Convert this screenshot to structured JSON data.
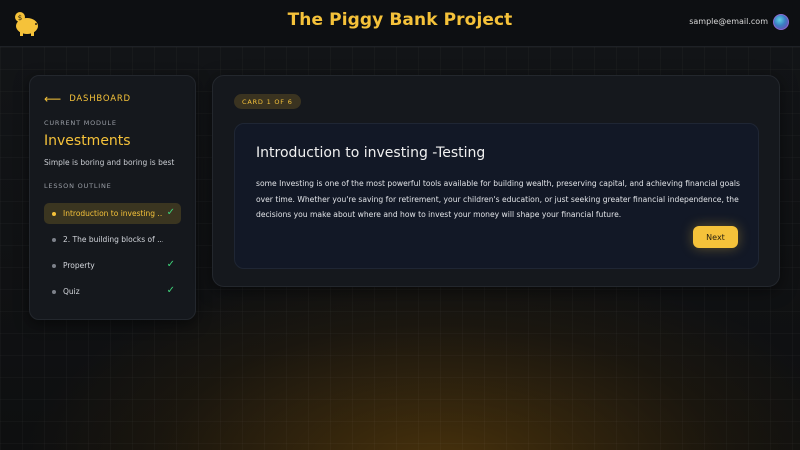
{
  "header": {
    "title": "The Piggy Bank Project",
    "user_email": "sample@email.com",
    "logo_icon": "piggy-bank-icon"
  },
  "sidebar": {
    "back_label": "DASHBOARD",
    "current_module_caption": "CURRENT MODULE",
    "module_title": "Investments",
    "module_subtitle": "Simple is boring and boring is best",
    "lesson_outline_caption": "LESSON OUTLINE",
    "lessons": [
      {
        "label": "Introduction to investing ...",
        "completed": true,
        "active": true
      },
      {
        "label": "2. The building blocks of ...",
        "completed": false,
        "active": false
      },
      {
        "label": "Property",
        "completed": true,
        "active": false
      },
      {
        "label": "Quiz",
        "completed": true,
        "active": false
      }
    ],
    "check_glyph": "✓"
  },
  "main": {
    "card_badge": "CARD 1 OF 6",
    "card_title": "Introduction to investing -Testing",
    "card_body": "some Investing is one of the most powerful tools available for building wealth, preserving capital, and achieving financial goals over time. Whether you're saving for retirement, your children's education, or just seeking greater financial independence, the decisions you make about where and how to invest your money will shape your financial future.",
    "next_label": "Next"
  },
  "colors": {
    "accent": "#f5c23a",
    "check": "#3fd27a",
    "panel": "#15181d",
    "card": "#121826"
  }
}
